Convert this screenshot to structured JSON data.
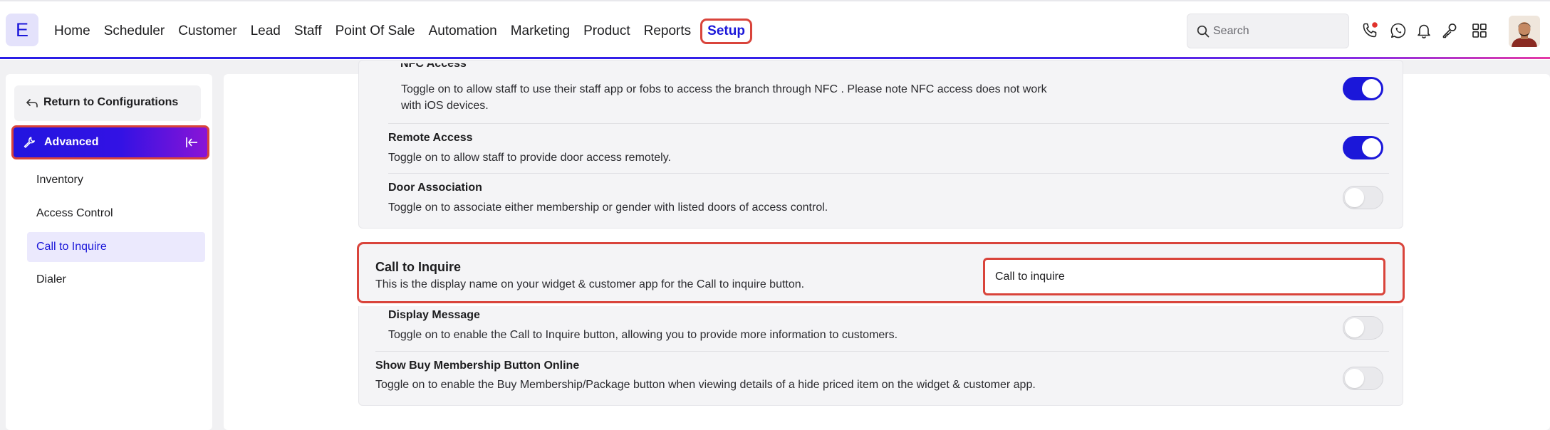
{
  "app": {
    "logo_letter": "E",
    "accent": "#1b17d9",
    "highlight": "#d9443b"
  },
  "nav": {
    "items": [
      {
        "label": "Home"
      },
      {
        "label": "Scheduler"
      },
      {
        "label": "Customer"
      },
      {
        "label": "Lead"
      },
      {
        "label": "Staff"
      },
      {
        "label": "Point Of Sale"
      },
      {
        "label": "Automation"
      },
      {
        "label": "Marketing"
      },
      {
        "label": "Product"
      },
      {
        "label": "Reports"
      },
      {
        "label": "Setup",
        "active": true
      }
    ],
    "search_placeholder": "Search",
    "icons": [
      "phone-icon",
      "whatsapp-icon",
      "bell-icon",
      "key-icon",
      "grid-icon"
    ]
  },
  "sidebar": {
    "return_label": "Return to Configurations",
    "section_label": "Advanced",
    "items": [
      {
        "label": "Inventory"
      },
      {
        "label": "Access Control"
      },
      {
        "label": "Call to Inquire",
        "active": true
      },
      {
        "label": "Dialer"
      }
    ]
  },
  "settings": {
    "nfc": {
      "title": "NFC Access",
      "desc": "Toggle on to allow staff to use their staff app or fobs to access the branch through NFC . Please note NFC access does not work with iOS devices.",
      "enabled": true
    },
    "remote": {
      "title": "Remote Access",
      "desc": "Toggle on to allow staff to provide door access remotely.",
      "enabled": true
    },
    "door": {
      "title": "Door Association",
      "desc": "Toggle on to associate either membership or gender with listed doors of access control.",
      "enabled": false
    },
    "call_to_inquire": {
      "title": "Call to Inquire",
      "desc": "This is the display name on your widget & customer app for the Call to inquire button.",
      "value": "Call to inquire"
    },
    "display_message": {
      "title": "Display Message",
      "desc": "Toggle on to enable the Call to Inquire button, allowing you to provide more information to customers.",
      "enabled": false
    },
    "buy_membership": {
      "title": "Show Buy Membership Button Online",
      "desc": "Toggle on to enable the Buy Membership/Package button when viewing details of a hide priced item on the widget & customer app.",
      "enabled": false
    }
  }
}
